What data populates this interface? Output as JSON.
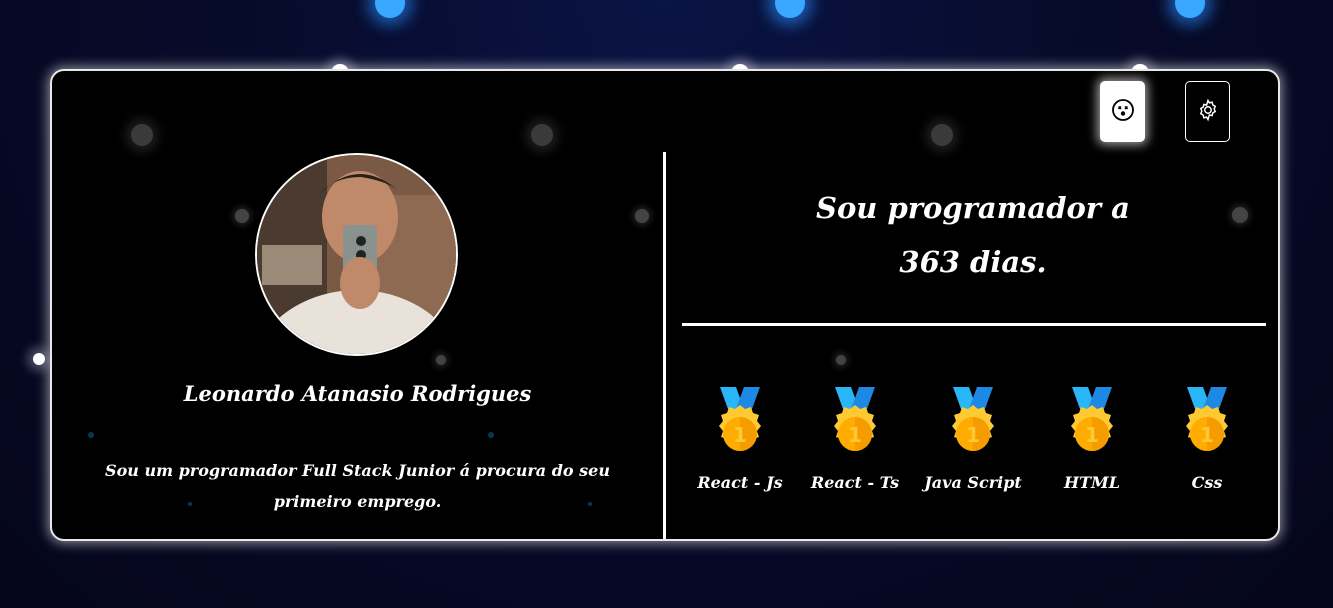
{
  "profile": {
    "name": "Leonardo Atanasio Rodrigues",
    "bio": "Sou um programador Full Stack Junior á procura do seu primeiro emprego."
  },
  "stats": {
    "line1": "Sou programador a",
    "line2": "363 dias."
  },
  "skills": [
    {
      "label": "React - Js",
      "icon": "gold-medal-icon"
    },
    {
      "label": "React - Ts",
      "icon": "gold-medal-icon"
    },
    {
      "label": "Java Script",
      "icon": "gold-medal-icon"
    },
    {
      "label": "HTML",
      "icon": "gold-medal-icon"
    },
    {
      "label": "Css",
      "icon": "gold-medal-icon"
    }
  ],
  "toolbar": {
    "theme_icon": "dizzy-face-icon",
    "settings_icon": "gear-icon"
  },
  "colors": {
    "card_background": "#000000",
    "page_background": "#070b2a",
    "glow_blue": "#3aa8ff",
    "medal_gold": "#ffc933",
    "ribbon_blue": "#1e88e5"
  }
}
